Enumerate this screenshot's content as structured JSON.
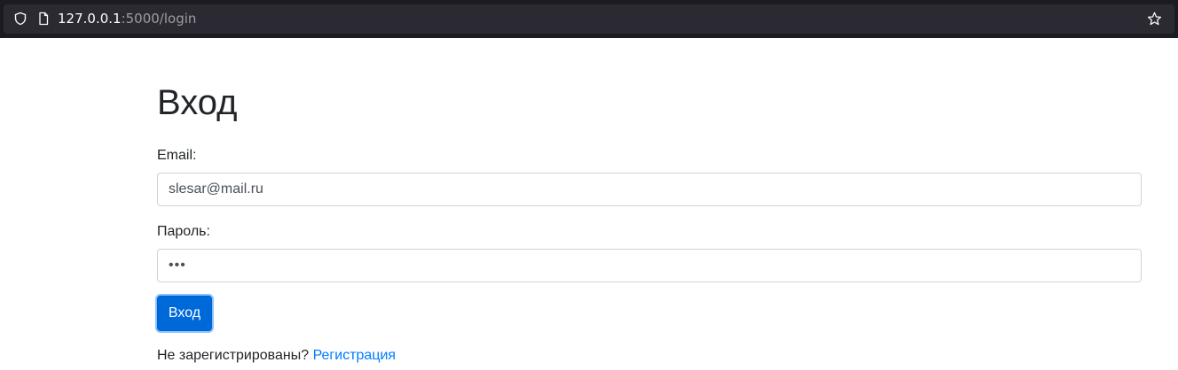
{
  "browser": {
    "url_host": "127.0.0.1",
    "url_rest": ":5000/login",
    "icons": {
      "shield": "shield-icon",
      "page": "page-icon",
      "star": "star-icon"
    }
  },
  "login_form": {
    "title": "Вход",
    "email_label": "Email:",
    "email_value": "slesar@mail.ru",
    "password_label": "Пароль:",
    "password_value": "•••",
    "submit_label": "Вход",
    "register_prompt": "Не зарегистрированы? ",
    "register_link": "Регистрация"
  },
  "colors": {
    "primary": "#0069d9",
    "link": "#007bff",
    "text": "#212529",
    "browser_chrome": "#1c1b22"
  }
}
